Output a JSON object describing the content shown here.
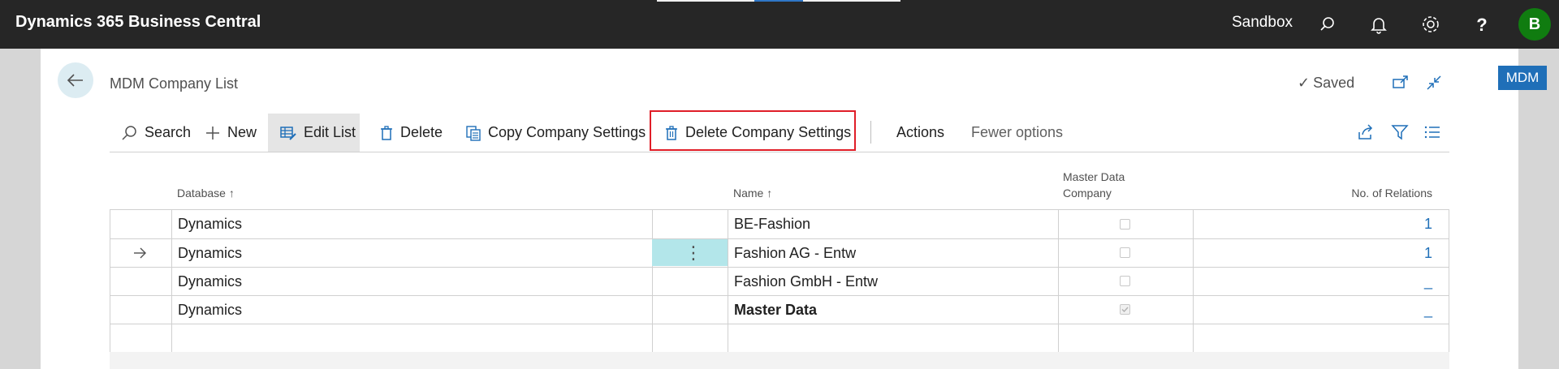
{
  "topbar": {
    "app_title": "Dynamics 365 Business Central",
    "environment": "Sandbox",
    "avatar_initial": "B",
    "avatar_color": "#107c10"
  },
  "page": {
    "title": "MDM Company List",
    "saved_label": "Saved",
    "badge": "MDM"
  },
  "actions": {
    "search": "Search",
    "new": "New",
    "edit_list": "Edit List",
    "delete": "Delete",
    "copy_company_settings": "Copy Company Settings",
    "delete_company_settings": "Delete Company Settings",
    "actions": "Actions",
    "fewer_options": "Fewer options"
  },
  "grid": {
    "headers": {
      "database": "Database",
      "name": "Name",
      "master_data_company_line1": "Master Data",
      "master_data_company_line2": "Company",
      "no_of_relations": "No. of Relations"
    },
    "rows": [
      {
        "database": "Dynamics",
        "name": "BE-Fashion",
        "master_data_company": false,
        "relations": "1"
      },
      {
        "database": "Dynamics",
        "name": "Fashion AG - Entw",
        "master_data_company": false,
        "relations": "1"
      },
      {
        "database": "Dynamics",
        "name": "Fashion GmbH - Entw",
        "master_data_company": false,
        "relations": "_"
      },
      {
        "database": "Dynamics",
        "name": "Master Data",
        "master_data_company": true,
        "relations": "_"
      }
    ]
  },
  "colors": {
    "accent": "#1f6fb8",
    "highlight": "#e01e28",
    "selected_cell": "#b3e6ea"
  }
}
